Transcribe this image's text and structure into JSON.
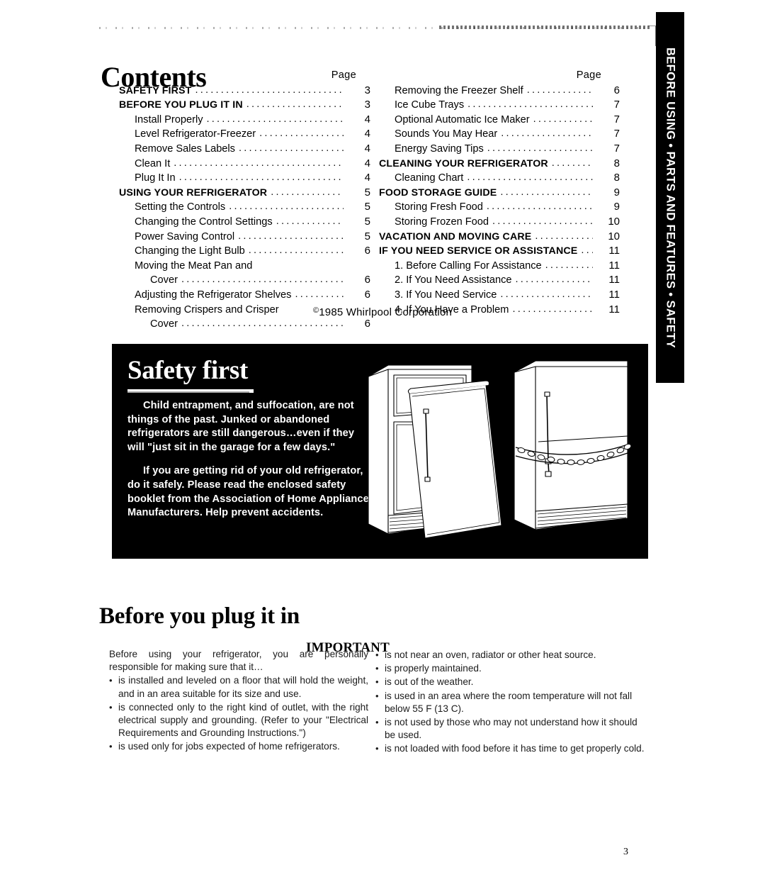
{
  "side_tab": {
    "label": "BEFORE USING • PARTS AND FEATURES • SAFETY"
  },
  "contents": {
    "heading": "Contents",
    "page_header": "Page",
    "left_column": [
      {
        "label": "SAFETY FIRST",
        "page": "3",
        "level": "major"
      },
      {
        "label": "BEFORE YOU PLUG IT IN",
        "page": "3",
        "level": "major"
      },
      {
        "label": "Install Properly",
        "page": "4",
        "level": "sub"
      },
      {
        "label": "Level Refrigerator-Freezer",
        "page": "4",
        "level": "sub"
      },
      {
        "label": "Remove Sales Labels",
        "page": "4",
        "level": "sub"
      },
      {
        "label": "Clean It",
        "page": "4",
        "level": "sub"
      },
      {
        "label": "Plug It In",
        "page": "4",
        "level": "sub"
      },
      {
        "label": "USING YOUR REFRIGERATOR",
        "page": "5",
        "level": "major"
      },
      {
        "label": "Setting the Controls",
        "page": "5",
        "level": "sub"
      },
      {
        "label": "Changing the Control Settings",
        "page": "5",
        "level": "sub"
      },
      {
        "label": "Power Saving Control",
        "page": "5",
        "level": "sub"
      },
      {
        "label": "Changing the Light Bulb",
        "page": "6",
        "level": "sub"
      },
      {
        "label": "Moving the Meat Pan and",
        "page": "",
        "level": "cont"
      },
      {
        "label": "Cover",
        "page": "6",
        "level": "sub2"
      },
      {
        "label": "Adjusting the Refrigerator Shelves",
        "page": "6",
        "level": "sub"
      },
      {
        "label": "Removing Crispers and Crisper",
        "page": "",
        "level": "cont"
      },
      {
        "label": "Cover",
        "page": "6",
        "level": "sub2"
      }
    ],
    "right_column": [
      {
        "label": "Removing the Freezer Shelf",
        "page": "6",
        "level": "sub"
      },
      {
        "label": "Ice Cube Trays",
        "page": "7",
        "level": "sub"
      },
      {
        "label": "Optional Automatic Ice Maker",
        "page": "7",
        "level": "sub"
      },
      {
        "label": "Sounds You May Hear",
        "page": "7",
        "level": "sub"
      },
      {
        "label": "Energy Saving Tips",
        "page": "7",
        "level": "sub"
      },
      {
        "label": "CLEANING YOUR REFRIGERATOR",
        "page": "8",
        "level": "major"
      },
      {
        "label": "Cleaning Chart",
        "page": "8",
        "level": "sub"
      },
      {
        "label": "FOOD STORAGE GUIDE",
        "page": "9",
        "level": "major"
      },
      {
        "label": "Storing Fresh Food",
        "page": "9",
        "level": "sub"
      },
      {
        "label": "Storing Frozen Food",
        "page": "10",
        "level": "sub"
      },
      {
        "label": "VACATION AND MOVING CARE",
        "page": "10",
        "level": "major"
      },
      {
        "label": "IF YOU NEED SERVICE OR ASSISTANCE",
        "page": "11",
        "level": "major"
      },
      {
        "label": "1. Before Calling For Assistance",
        "page": "11",
        "level": "sub"
      },
      {
        "label": "2. If You Need Assistance",
        "page": "11",
        "level": "sub"
      },
      {
        "label": "3. If You Need Service",
        "page": "11",
        "level": "sub"
      },
      {
        "label": "4. If You Have a Problem",
        "page": "11",
        "level": "sub"
      }
    ]
  },
  "copyright": {
    "symbol": "©",
    "text": "1985 Whirlpool Corporation"
  },
  "safety_box": {
    "title": "Safety first",
    "paragraph_1": "Child entrapment, and suffocation, are not things of the past. Junked or abandoned refrigerators are still dangerous…even if they will \"just sit in the garage for a few days.\"",
    "paragraph_2": "If you are getting rid of your old refrigerator, do it safely. Please read the enclosed safety booklet from the Association of Home Appliance Manufacturers. Help prevent accidents.",
    "illustration_name": "refrigerator-door-removal-and-chained-door-drawing"
  },
  "plug_section": {
    "heading": "Before you plug it in",
    "important_heading": "IMPORTANT",
    "intro": "Before using your refrigerator, you are personally responsible for making sure that it…",
    "left_bullets": [
      "is installed and leveled on a floor that will hold the weight, and in an area suitable for its size and use.",
      "is connected only to the right kind of outlet, with the right electrical supply and grounding. (Refer to your \"Electrical Requirements and Grounding Instructions.\")",
      "is used only for jobs expected of home refrigerators."
    ],
    "right_bullets": [
      "is not near an oven, radiator or other heat source.",
      "is properly maintained.",
      "is out of the weather.",
      "is used in an area where the room temperature will not fall below 55 F (13 C).",
      "is not used by those who may not understand how it should be used.",
      "is not loaded with food before it has time to get properly cold."
    ],
    "bullet_glyph": "•"
  },
  "folio": {
    "page_number": "3"
  }
}
